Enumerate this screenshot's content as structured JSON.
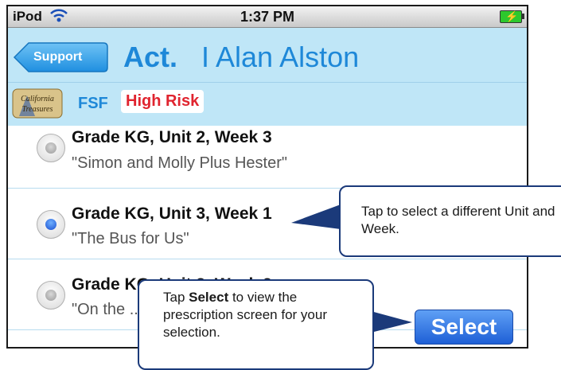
{
  "status_bar": {
    "carrier": "iPod",
    "time": "1:37 PM"
  },
  "nav": {
    "back_label": "Support",
    "title_act": "Act.",
    "title_name": "I Alan Alston"
  },
  "subheader": {
    "logo_text": "California Treasures",
    "program": "FSF",
    "risk_badge": "High Risk"
  },
  "list": [
    {
      "title": "Grade KG, Unit 2, Week 3",
      "subtitle": "\"Simon and Molly Plus Hester\"",
      "selected": false
    },
    {
      "title": "Grade KG, Unit 3, Week 1",
      "subtitle": "\"The Bus for Us\"",
      "selected": true
    },
    {
      "title": "Grade KG, Unit 3, Week 2",
      "subtitle": "\"On the ...",
      "selected": false
    }
  ],
  "select_button": {
    "label": "Select"
  },
  "callouts": {
    "unit_week": "Tap to select a different Unit and Week.",
    "select_prefix": "Tap ",
    "select_bold": "Select",
    "select_suffix": " to view the prescription screen for your selection."
  },
  "colors": {
    "accent": "#1e88d8",
    "header_bg": "#bfe6f7",
    "risk": "#e0242f",
    "callout_border": "#1b3a7a"
  }
}
